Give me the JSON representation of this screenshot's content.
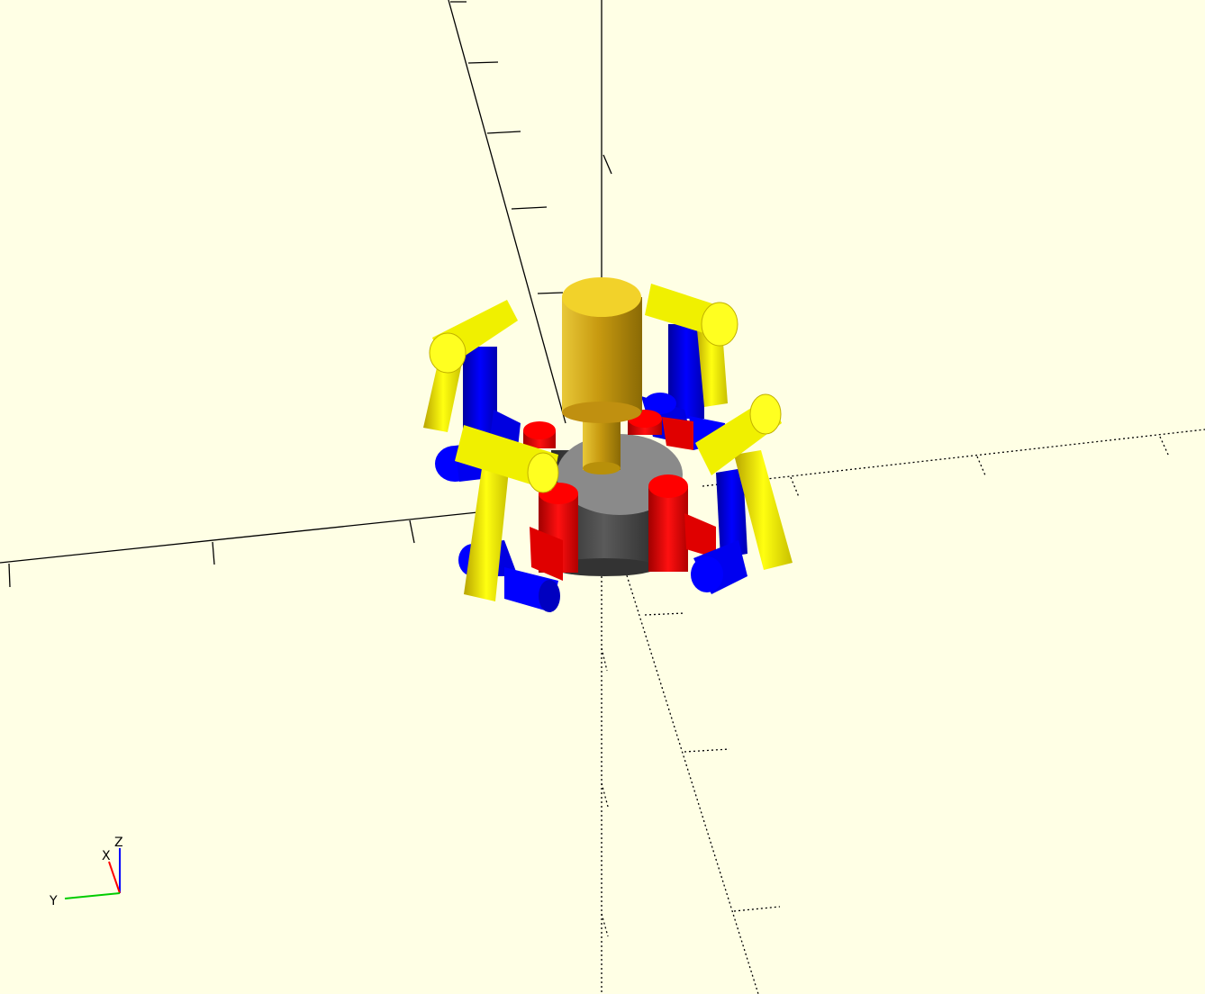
{
  "viewport": {
    "background": "#FFFFE5",
    "model_colors": {
      "base": "#8c8c8c",
      "spindle": "#e6c020",
      "red_parts": "#ff0000",
      "blue_parts": "#0000ff",
      "yellow_arms": "#ffff00"
    }
  },
  "axes_gizmo": {
    "x_label": "X",
    "y_label": "Y",
    "z_label": "Z",
    "x_color": "#ff0000",
    "y_color": "#00cc00",
    "z_color": "#0000ff"
  }
}
